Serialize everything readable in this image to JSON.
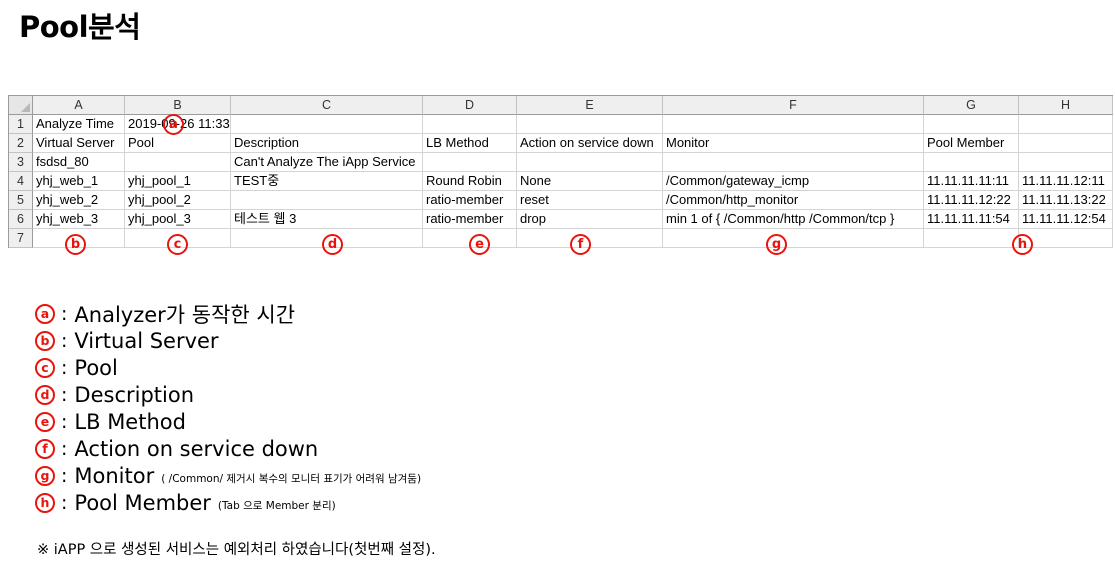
{
  "page_title": "Pool분석",
  "sheet": {
    "columns": [
      "A",
      "B",
      "C",
      "D",
      "E",
      "F",
      "G",
      "H"
    ],
    "rows": [
      {
        "num": "1",
        "cells": [
          "Analyze Time",
          "2019-09-26 11:33",
          "",
          "",
          "",
          "",
          "",
          ""
        ]
      },
      {
        "num": "2",
        "cells": [
          "Virtual Server",
          "Pool",
          "Description",
          "LB Method",
          "Action on service down",
          "Monitor",
          "Pool Member",
          ""
        ]
      },
      {
        "num": "3",
        "cells": [
          "fsdsd_80",
          "",
          "Can't Analyze The iApp Service",
          "",
          "",
          "",
          "",
          ""
        ]
      },
      {
        "num": "4",
        "cells": [
          "yhj_web_1",
          "yhj_pool_1",
          "TEST중",
          "Round Robin",
          "None",
          "/Common/gateway_icmp",
          "11.11.11.11:11",
          "11.11.11.12:11"
        ]
      },
      {
        "num": "5",
        "cells": [
          "yhj_web_2",
          "yhj_pool_2",
          "",
          "ratio-member",
          "reset",
          "/Common/http_monitor",
          "11.11.11.12:22",
          "11.11.11.13:22"
        ]
      },
      {
        "num": "6",
        "cells": [
          "yhj_web_3",
          "yhj_pool_3",
          "테스트 웹 3",
          "ratio-member",
          "drop",
          "min 1 of { /Common/http /Common/tcp }",
          "11.11.11.11:54",
          "11.11.11.12:54"
        ]
      },
      {
        "num": "7",
        "cells": [
          "",
          "",
          "",
          "",
          "",
          "",
          "",
          ""
        ]
      }
    ]
  },
  "markers": [
    "a",
    "b",
    "c",
    "d",
    "e",
    "f",
    "g",
    "h"
  ],
  "legend": [
    {
      "mark": "a",
      "sep": ":",
      "text": "Analyzer가 동작한 시간",
      "note": ""
    },
    {
      "mark": "b",
      "sep": ":",
      "text": "Virtual Server",
      "note": ""
    },
    {
      "mark": "c",
      "sep": ":",
      "text": "Pool",
      "note": ""
    },
    {
      "mark": "d",
      "sep": ":",
      "text": "Description",
      "note": ""
    },
    {
      "mark": "e",
      "sep": ":",
      "text": "LB Method",
      "note": ""
    },
    {
      "mark": "f",
      "sep": ":",
      "text": "Action on service down",
      "note": ""
    },
    {
      "mark": "g",
      "sep": ":",
      "text": "Monitor",
      "note": "( /Common/ 제거시 복수의 모니터 표기가 어려워 남겨둠)"
    },
    {
      "mark": "h",
      "sep": ":",
      "text": "Pool Member",
      "note": "(Tab 으로 Member 분리)"
    }
  ],
  "footnote": "※ iAPP 으로 생성된 서비스는 예외처리 하였습니다(첫번째 설정).",
  "colors": {
    "accent_red": "#e8150f",
    "header_bg": "#efefef",
    "grid_line": "#d4d4d4"
  }
}
